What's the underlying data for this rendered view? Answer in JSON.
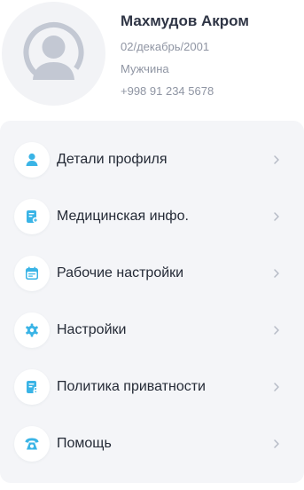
{
  "profile": {
    "name": "Махмудов Акром",
    "birthdate": "02/декабрь/2001",
    "gender": "Мужчина",
    "phone": "+998 91 234 5678"
  },
  "menu": {
    "items": [
      {
        "label": "Детали профиля",
        "icon": "user-icon"
      },
      {
        "label": "Медицинская инфо.",
        "icon": "medical-record-icon"
      },
      {
        "label": "Рабочие настройки",
        "icon": "calendar-icon"
      },
      {
        "label": "Настройки",
        "icon": "gear-icon"
      },
      {
        "label": "Политика приватности",
        "icon": "document-lock-icon"
      },
      {
        "label": "Помощь",
        "icon": "phone-icon"
      }
    ]
  },
  "colors": {
    "accent": "#3ab4e6",
    "text_primary": "#242a36",
    "text_secondary": "#8f95a3",
    "card_background": "#f4f5f8",
    "avatar_background": "#f2f3f6",
    "avatar_silhouette": "#c3c8d3"
  }
}
